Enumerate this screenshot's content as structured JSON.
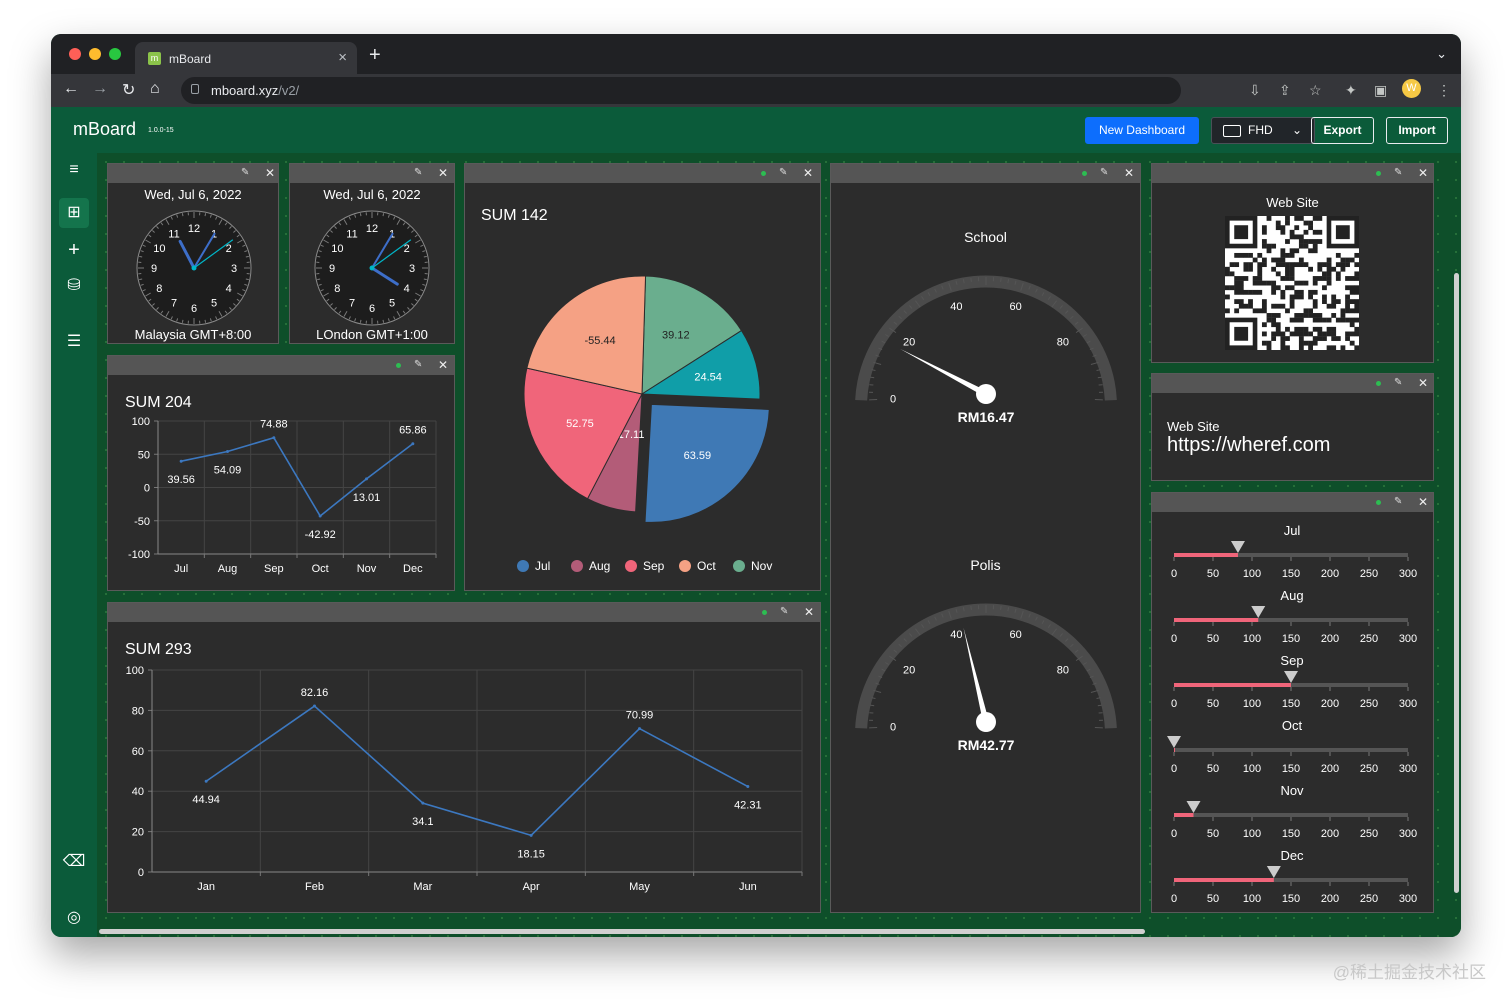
{
  "browser": {
    "tab_title": "mBoard",
    "url_host": "mboard.xyz",
    "url_path": "/v2/"
  },
  "app": {
    "name": "mBoard",
    "version": "1.0.0-15",
    "new_dashboard_label": "New Dashboard",
    "resolution_label": "FHD",
    "export_label": "Export",
    "import_label": "Import"
  },
  "clocks": [
    {
      "date": "Wed, Jul 6, 2022",
      "label": "Malaysia GMT+8:00",
      "numerals": [
        "12",
        "1",
        "2",
        "3",
        "4",
        "5",
        "6",
        "7",
        "8",
        "9",
        "10",
        "11"
      ],
      "time": "23:05:09"
    },
    {
      "date": "Wed, Jul 6, 2022",
      "label": "LOndon GMT+1:00",
      "numerals": [
        "12",
        "1",
        "2",
        "3",
        "4",
        "5",
        "6",
        "7",
        "8",
        "9",
        "10",
        "11"
      ],
      "time": "16:05:09"
    }
  ],
  "sum204": {
    "title": "SUM 204",
    "chart_data": {
      "type": "line",
      "categories": [
        "Jul",
        "Aug",
        "Sep",
        "Oct",
        "Nov",
        "Dec"
      ],
      "values": [
        39.56,
        54.09,
        74.88,
        -42.92,
        13.01,
        65.86
      ],
      "ylim": [
        -100,
        100
      ],
      "yticks": [
        100,
        50,
        0,
        -50,
        -100
      ],
      "color": "#3c78c0"
    }
  },
  "sum142": {
    "title": "SUM 142",
    "chart_data": {
      "type": "pie",
      "labels": [
        "Jul",
        "Aug",
        "Sep",
        "Oct",
        "Nov"
      ],
      "values": [
        63.59,
        17.11,
        52.75,
        -55.44,
        39.12,
        24.54
      ],
      "slice_values": [
        39.12,
        24.54,
        63.59,
        17.11,
        52.75,
        -55.44
      ],
      "slice_colors": [
        "#6aae8e",
        "#109ea8",
        "#3f79b5",
        "#b35c78",
        "#f0657a",
        "#f5a184"
      ],
      "legend": [
        "Jul",
        "Aug",
        "Sep",
        "Oct",
        "Nov"
      ],
      "legend_colors": [
        "#3f79b5",
        "#b35c78",
        "#f0657a",
        "#f5a184",
        "#6aae8e"
      ]
    }
  },
  "gauges": [
    {
      "title": "School",
      "value": 16.47,
      "value_label": "RM16.47",
      "ticks": [
        "0",
        "20",
        "40",
        "60",
        "80"
      ]
    },
    {
      "title": "Polis",
      "value": 42.77,
      "value_label": "RM42.77",
      "ticks": [
        "0",
        "20",
        "40",
        "60",
        "80"
      ]
    }
  ],
  "qr": {
    "title": "Web Site"
  },
  "website": {
    "label": "Web Site",
    "value": "https://wheref.com"
  },
  "sliders": {
    "ticks": [
      "0",
      "50",
      "100",
      "150",
      "200",
      "250",
      "300"
    ],
    "items": [
      {
        "label": "Jul",
        "value": 82
      },
      {
        "label": "Aug",
        "value": 108
      },
      {
        "label": "Sep",
        "value": 150
      },
      {
        "label": "Oct",
        "value": 0
      },
      {
        "label": "Nov",
        "value": 25
      },
      {
        "label": "Dec",
        "value": 128
      }
    ]
  },
  "sum293": {
    "title": "SUM 293",
    "chart_data": {
      "type": "line",
      "categories": [
        "Jan",
        "Feb",
        "Mar",
        "Apr",
        "May",
        "Jun"
      ],
      "values": [
        44.94,
        82.16,
        34.1,
        18.15,
        70.99,
        42.31
      ],
      "ylim": [
        0,
        100
      ],
      "yticks": [
        100,
        80,
        60,
        40,
        20,
        0
      ],
      "color": "#3c78c0"
    }
  },
  "watermark": "@稀土掘金技术社区"
}
